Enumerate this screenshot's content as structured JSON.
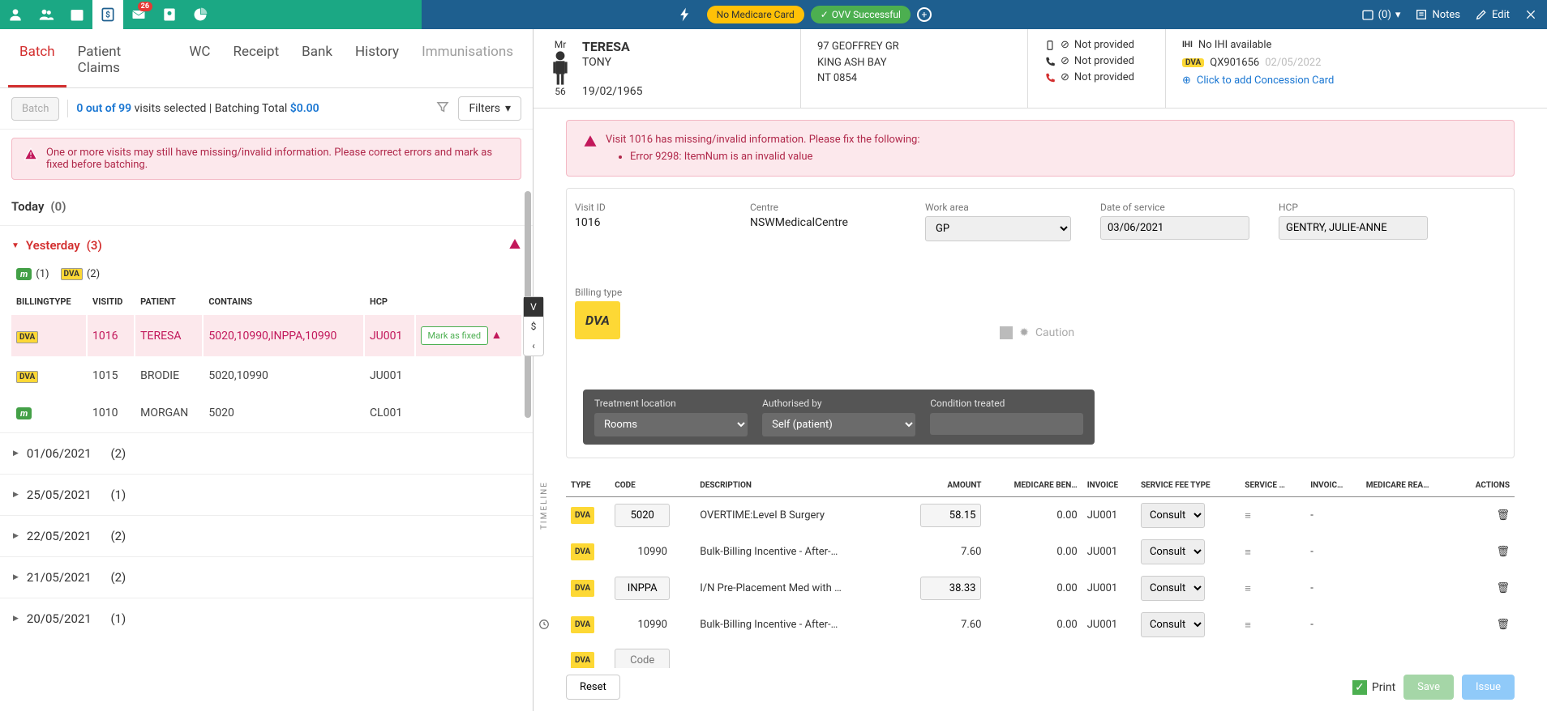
{
  "toolbar": {
    "mail_badge": "26",
    "no_medicare": "No Medicare Card",
    "ovv": "OVV Successful",
    "calendar_count": "(0)",
    "notes": "Notes",
    "edit": "Edit"
  },
  "left": {
    "tabs": {
      "batch": "Batch",
      "patient_claims": "Patient Claims",
      "wc": "WC",
      "receipt": "Receipt",
      "bank": "Bank",
      "history": "History",
      "immunisations": "Immunisations"
    },
    "batch_btn": "Batch",
    "batch_summary_1": "0 out of ",
    "batch_summary_2": "99",
    "batch_summary_3": " visits selected | Batching Total ",
    "batch_summary_4": "$0.00",
    "filters_label": "Filters",
    "warning": "One or more visits may still have missing/invalid information. Please correct errors and mark as fixed before batching.",
    "today": "Today",
    "today_count": "(0)",
    "yesterday": "Yesterday",
    "yesterday_count": "(3)",
    "chip_m_count": "(1)",
    "chip_dva_count": "(2)",
    "cols": {
      "billing": "BILLINGTYPE",
      "visitid": "VISITID",
      "patient": "PATIENT",
      "contains": "CONTAINS",
      "hcp": "HCP"
    },
    "rows": [
      {
        "type": "DVA",
        "visit": "1016",
        "patient": "TERESA",
        "contains": "5020,10990,INPPA,10990",
        "hcp": "JU001",
        "selected": true,
        "fixable": true
      },
      {
        "type": "DVA",
        "visit": "1015",
        "patient": "BRODIE",
        "contains": "5020,10990",
        "hcp": "JU001",
        "selected": false
      },
      {
        "type": "M",
        "visit": "1010",
        "patient": "MORGAN",
        "contains": "5020",
        "hcp": "CL001",
        "selected": false
      }
    ],
    "mark_fixed": "Mark as fixed",
    "groups": [
      {
        "date": "01/06/2021",
        "count": "(2)"
      },
      {
        "date": "25/05/2021",
        "count": "(1)"
      },
      {
        "date": "22/05/2021",
        "count": "(2)"
      },
      {
        "date": "21/05/2021",
        "count": "(2)"
      },
      {
        "date": "20/05/2021",
        "count": "(1)"
      }
    ],
    "timeline": "TIMELINE"
  },
  "patient": {
    "title": "Mr",
    "surname": "TERESA",
    "firstname": "TONY",
    "age": "56",
    "dob": "19/02/1965",
    "addr1": "97 GEOFFREY GR",
    "addr2": "KING ASH BAY",
    "addr3": "NT 0854",
    "not_provided": "Not provided",
    "ihi_label": "IHI",
    "ihi_value": "No IHI available",
    "card_no": "QX901656",
    "card_date": "02/05/2022",
    "add_concession": "Click to add Concession Card"
  },
  "right_alert": {
    "title": "Visit 1016 has missing/invalid information. Please fix the following:",
    "item1": "Error 9298: ItemNum is an invalid value"
  },
  "fields": {
    "visit_id_label": "Visit ID",
    "visit_id": "1016",
    "centre_label": "Centre",
    "centre": "NSWMedicalCentre",
    "work_area_label": "Work area",
    "work_area": "GP",
    "dos_label": "Date of service",
    "dos": "03/06/2021",
    "hcp_label": "HCP",
    "hcp": "GENTRY, JULIE-ANNE",
    "billing_type_label": "Billing type",
    "billing_type": "DVA",
    "caution": "Caution",
    "tloc_label": "Treatment location",
    "tloc": "Rooms",
    "auth_label": "Authorised by",
    "auth": "Self (patient)",
    "cond_label": "Condition treated",
    "cond": ""
  },
  "items": {
    "cols": {
      "type": "TYPE",
      "code": "CODE",
      "desc": "DESCRIPTION",
      "amount": "AMOUNT",
      "medben": "MEDICARE BEN…",
      "invoice": "INVOICE",
      "sft": "SERVICE FEE TYPE",
      "service": "SERVICE …",
      "invoic": "INVOIC…",
      "medrea": "MEDICARE REA…",
      "actions": "ACTIONS"
    },
    "rows": [
      {
        "type": "DVA",
        "code": "5020",
        "code_boxed": true,
        "desc": "OVERTIME:Level B Surgery",
        "amount": "58.15",
        "amount_boxed": true,
        "medben": "0.00",
        "invoice": "JU001",
        "sft": "Consult",
        "invd": "-"
      },
      {
        "type": "DVA",
        "code": "10990",
        "code_boxed": false,
        "desc": "Bulk-Billing Incentive - After-…",
        "amount": "7.60",
        "amount_boxed": false,
        "medben": "0.00",
        "invoice": "JU001",
        "sft": "Consult",
        "invd": "-"
      },
      {
        "type": "DVA",
        "code": "INPPA",
        "code_boxed": true,
        "desc": "I/N Pre-Placement Med with …",
        "amount": "38.33",
        "amount_boxed": true,
        "medben": "0.00",
        "invoice": "JU001",
        "sft": "Consult",
        "invd": "-"
      },
      {
        "type": "DVA",
        "code": "10990",
        "code_boxed": false,
        "desc": "Bulk-Billing Incentive - After-…",
        "amount": "7.60",
        "amount_boxed": false,
        "medben": "0.00",
        "invoice": "JU001",
        "sft": "Consult",
        "invd": "-"
      }
    ],
    "placeholder_code": "Code"
  },
  "footer": {
    "reset": "Reset",
    "print": "Print",
    "save": "Save",
    "issue": "Issue"
  }
}
